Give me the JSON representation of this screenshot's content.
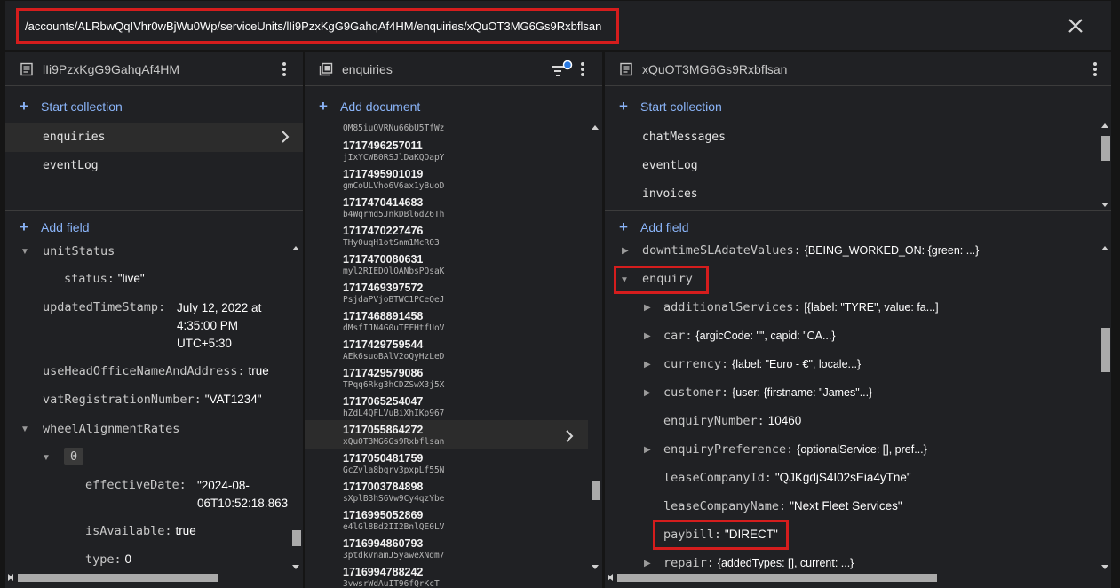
{
  "path": {
    "text": "/accounts/ALRbwQqIVhr0wBjWu0Wp/serviceUnits/lIi9PzxKgG9GahqAf4HM/enquiries/xQuOT3MG6Gs9Rxbflsan"
  },
  "pane1": {
    "title": "lIi9PzxKgG9GahqAf4HM",
    "start_collection": "Start collection",
    "collections": [
      "enquiries",
      "eventLog"
    ],
    "add_field": "Add field",
    "fields": {
      "unitStatus": "unitStatus",
      "status_key": "status:",
      "status_val": "\"live\"",
      "updated_key": "updatedTimeStamp:",
      "updated_val_1": "July 12, 2022 at",
      "updated_val_2": "4:35:00 PM",
      "updated_val_3": "UTC+5:30",
      "usehead_key": "useHeadOfficeNameAndAddress:",
      "usehead_val": "true",
      "vat_key": "vatRegistrationNumber:",
      "vat_val": "\"VAT1234\"",
      "wheel_key": "wheelAlignmentRates",
      "index_0": "0",
      "effective_key": "effectiveDate:",
      "effective_val_1": "\"2024-08-",
      "effective_val_2": "06T10:52:18.863",
      "avail_key": "isAvailable:",
      "avail_val": "true",
      "type_key": "type:",
      "type_val": "0"
    }
  },
  "pane2": {
    "title": "enquiries",
    "add_document": "Add document",
    "top_id": "QM85iuQVRNu66bU5TfWz",
    "docs": [
      {
        "ts": "1717496257011",
        "id": "jIxYCWB0RSJlDaKQOapY"
      },
      {
        "ts": "1717495901019",
        "id": "gmCoULVho6V6ax1yBuoD"
      },
      {
        "ts": "1717470414683",
        "id": "b4Wqrmd5JnkDBl6dZ6Th"
      },
      {
        "ts": "1717470227476",
        "id": "THy0uqH1otSnm1McR03"
      },
      {
        "ts": "1717470080631",
        "id": "myl2RIEDQlOANbsPQsaK"
      },
      {
        "ts": "1717469397572",
        "id": "PsjdaPVjoBTWC1PCeQeJ"
      },
      {
        "ts": "1717468891458",
        "id": "dMsfIJN4G0uTFFHtfUoV"
      },
      {
        "ts": "1717429759544",
        "id": "AEk6suoBAlV2oQyHzLeD"
      },
      {
        "ts": "1717429579086",
        "id": "TPqq6Rkg3hCDZSwX3j5X"
      },
      {
        "ts": "1717065254047",
        "id": "hZdL4QFLVuBiXhIKp967"
      },
      {
        "ts": "1717055864272",
        "id": "xQuOT3MG6Gs9Rxbflsan"
      },
      {
        "ts": "1717050481759",
        "id": "GcZvla8bqrv3pxpLf55N"
      },
      {
        "ts": "1717003784898",
        "id": "sXplB3hS6Vw9Cy4qzYbe"
      },
      {
        "ts": "1716995052869",
        "id": "e4lGl8Bd2II2BnlQE0LV"
      },
      {
        "ts": "1716994860793",
        "id": "3ptdkVnamJ5yaweXNdm7"
      },
      {
        "ts": "1716994788242",
        "id": "3vwsrWdAuIT96fQrKcT"
      }
    ]
  },
  "pane3": {
    "title": "xQuOT3MG6Gs9Rxbflsan",
    "start_collection": "Start collection",
    "collections": [
      "chatMessages",
      "eventLog",
      "invoices"
    ],
    "add_field": "Add field",
    "fields": {
      "downtime_key": "downtimeSLAdateValues:",
      "downtime_val": "{BEING_WORKED_ON: {green: ...}",
      "enquiry_key": "enquiry",
      "addl_key": "additionalServices:",
      "addl_val": "[{label: \"TYRE\", value: fa...]",
      "car_key": "car:",
      "car_val": "{argicCode: \"\", capid: \"CA...}",
      "currency_key": "currency:",
      "currency_val": "{label: \"Euro - €\", locale...}",
      "customer_key": "customer:",
      "customer_val": "{user: {firstname: \"James\"...}",
      "enqnum_key": "enquiryNumber:",
      "enqnum_val": "10460",
      "enqpref_key": "enquiryPreference:",
      "enqpref_val": "{optionalService: [], pref...}",
      "leaseid_key": "leaseCompanyId:",
      "leaseid_val": "\"QJKgdjS4I02sEia4yTne\"",
      "leasename_key": "leaseCompanyName:",
      "leasename_val": "\"Next Fleet Services\"",
      "paybill_key": "paybill:",
      "paybill_val": "\"DIRECT\"",
      "repair_key": "repair:",
      "repair_val": "{addedTypes: [], current: ...}"
    }
  },
  "colors": {
    "accent": "#8ab4f8",
    "highlight": "#d51d1d",
    "panel": "#202124",
    "background": "#151515"
  },
  "icons": [
    "close-icon",
    "document-icon",
    "collection-icon",
    "filter-icon",
    "kebab-menu-icon",
    "chevron-right-icon",
    "plus-icon"
  ]
}
